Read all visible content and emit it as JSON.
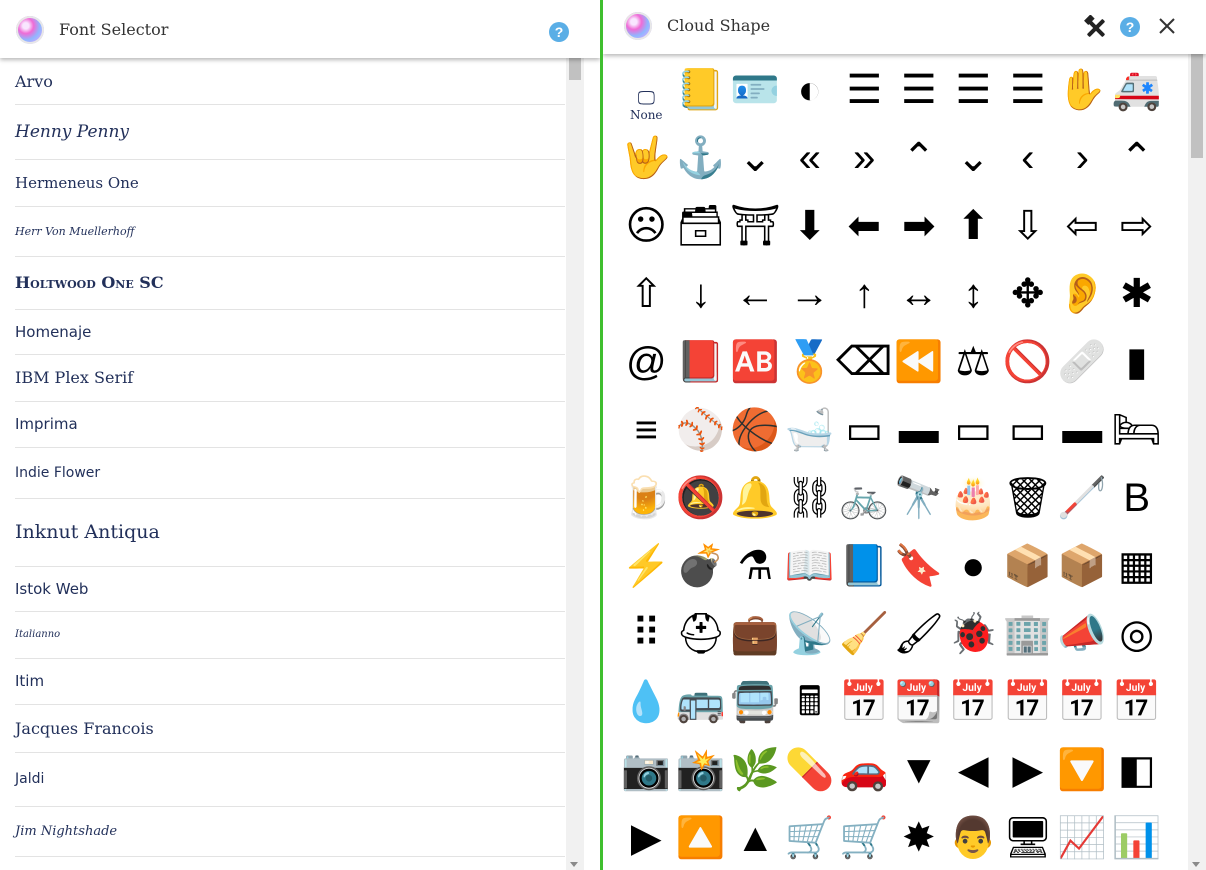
{
  "left_panel": {
    "title": "Font Selector",
    "help_icon": "?"
  },
  "fonts": [
    {
      "name": "Arvo",
      "font": "DejaVu Serif",
      "size": 16,
      "height": 46,
      "style": "normal",
      "weight": "normal",
      "variant": "normal"
    },
    {
      "name": "Henny Penny",
      "font": "DejaVu Serif",
      "size": 17,
      "height": 55,
      "style": "italic",
      "weight": "normal",
      "variant": "normal"
    },
    {
      "name": "Hermeneus One",
      "font": "DejaVu Serif",
      "size": 15,
      "height": 47,
      "style": "normal",
      "weight": "normal",
      "variant": "normal"
    },
    {
      "name": "Herr Von Muellerhoff",
      "font": "DejaVu Serif",
      "size": 11,
      "height": 50,
      "style": "italic",
      "weight": "normal",
      "variant": "normal"
    },
    {
      "name": "Holtwood One SC",
      "font": "DejaVu Serif",
      "size": 16,
      "height": 53,
      "style": "normal",
      "weight": "bold",
      "variant": "small-caps"
    },
    {
      "name": "Homenaje",
      "font": "DejaVu Sans",
      "size": 15,
      "height": 45,
      "style": "normal",
      "weight": "normal",
      "variant": "normal"
    },
    {
      "name": "IBM Plex Serif",
      "font": "DejaVu Serif",
      "size": 16,
      "height": 47,
      "style": "normal",
      "weight": "normal",
      "variant": "normal"
    },
    {
      "name": "Imprima",
      "font": "DejaVu Sans",
      "size": 15,
      "height": 46,
      "style": "normal",
      "weight": "normal",
      "variant": "normal"
    },
    {
      "name": "Indie Flower",
      "font": "DejaVu Sans",
      "size": 14,
      "height": 51,
      "style": "normal",
      "weight": "normal",
      "variant": "normal"
    },
    {
      "name": "Inknut Antiqua",
      "font": "DejaVu Serif",
      "size": 19,
      "height": 68,
      "style": "normal",
      "weight": "normal",
      "variant": "normal"
    },
    {
      "name": "Istok Web",
      "font": "DejaVu Sans",
      "size": 15,
      "height": 45,
      "style": "normal",
      "weight": "normal",
      "variant": "normal"
    },
    {
      "name": "Italianno",
      "font": "DejaVu Serif",
      "size": 10,
      "height": 47,
      "style": "italic",
      "weight": "normal",
      "variant": "normal"
    },
    {
      "name": "Itim",
      "font": "DejaVu Sans",
      "size": 15,
      "height": 46,
      "style": "normal",
      "weight": "normal",
      "variant": "normal"
    },
    {
      "name": "Jacques Francois",
      "font": "DejaVu Serif",
      "size": 16,
      "height": 48,
      "style": "normal",
      "weight": "normal",
      "variant": "normal"
    },
    {
      "name": "Jaldi",
      "font": "DejaVu Sans",
      "size": 14,
      "height": 54,
      "style": "normal",
      "weight": "normal",
      "variant": "normal"
    },
    {
      "name": "Jim Nightshade",
      "font": "DejaVu Serif",
      "size": 13,
      "height": 50,
      "style": "italic",
      "weight": "normal",
      "variant": "normal"
    }
  ],
  "right_panel": {
    "title": "Cloud Shape",
    "help_icon": "?",
    "close_icon": "✕",
    "tools_icon": "tools-icon"
  },
  "shapes_none_label": "None",
  "shapes": [
    {
      "name": "none",
      "glyph": "🖵"
    },
    {
      "name": "address-book-icon",
      "glyph": "📒"
    },
    {
      "name": "address-card-icon",
      "glyph": "🪪"
    },
    {
      "name": "adjust-icon",
      "glyph": "◐"
    },
    {
      "name": "align-center-icon",
      "glyph": "☰"
    },
    {
      "name": "align-justify-icon",
      "glyph": "☰"
    },
    {
      "name": "align-left-icon",
      "glyph": "☰"
    },
    {
      "name": "align-right-icon",
      "glyph": "☰"
    },
    {
      "name": "allergies-icon",
      "glyph": "✋"
    },
    {
      "name": "ambulance-icon",
      "glyph": "🚑"
    },
    {
      "name": "sign-language-icon",
      "glyph": "🤟"
    },
    {
      "name": "anchor-icon",
      "glyph": "⚓"
    },
    {
      "name": "angle-double-down-icon",
      "glyph": "⌄"
    },
    {
      "name": "angle-double-left-icon",
      "glyph": "«"
    },
    {
      "name": "angle-double-right-icon",
      "glyph": "»"
    },
    {
      "name": "angle-double-up-icon",
      "glyph": "⌃"
    },
    {
      "name": "angle-down-icon",
      "glyph": "⌄"
    },
    {
      "name": "angle-left-icon",
      "glyph": "‹"
    },
    {
      "name": "angle-right-icon",
      "glyph": "›"
    },
    {
      "name": "angle-up-icon",
      "glyph": "⌃"
    },
    {
      "name": "angry-icon",
      "glyph": "☹"
    },
    {
      "name": "archive-icon",
      "glyph": "🗃"
    },
    {
      "name": "archway-icon",
      "glyph": "⛩"
    },
    {
      "name": "arrow-circle-down-icon",
      "glyph": "⬇"
    },
    {
      "name": "arrow-circle-left-icon",
      "glyph": "⬅"
    },
    {
      "name": "arrow-circle-right-icon",
      "glyph": "➡"
    },
    {
      "name": "arrow-circle-up-icon",
      "glyph": "⬆"
    },
    {
      "name": "arrow-alt-circle-down-icon",
      "glyph": "⇩"
    },
    {
      "name": "arrow-alt-circle-left-icon",
      "glyph": "⇦"
    },
    {
      "name": "arrow-alt-circle-right-icon",
      "glyph": "⇨"
    },
    {
      "name": "arrow-alt-circle-up-icon",
      "glyph": "⇧"
    },
    {
      "name": "arrow-down-icon",
      "glyph": "↓"
    },
    {
      "name": "arrow-left-icon",
      "glyph": "←"
    },
    {
      "name": "arrow-right-icon",
      "glyph": "→"
    },
    {
      "name": "arrow-up-icon",
      "glyph": "↑"
    },
    {
      "name": "arrows-alt-h-icon",
      "glyph": "↔"
    },
    {
      "name": "arrows-alt-v-icon",
      "glyph": "↕"
    },
    {
      "name": "arrows-alt-icon",
      "glyph": "✥"
    },
    {
      "name": "assistive-listening-icon",
      "glyph": "👂"
    },
    {
      "name": "asterisk-icon",
      "glyph": "✱"
    },
    {
      "name": "at-icon",
      "glyph": "@"
    },
    {
      "name": "atlas-icon",
      "glyph": "📕"
    },
    {
      "name": "ad-icon",
      "glyph": "🆎"
    },
    {
      "name": "award-icon",
      "glyph": "🏅"
    },
    {
      "name": "backspace-icon",
      "glyph": "⌫"
    },
    {
      "name": "backward-icon",
      "glyph": "⏪"
    },
    {
      "name": "balance-scale-icon",
      "glyph": "⚖"
    },
    {
      "name": "ban-icon",
      "glyph": "🚫"
    },
    {
      "name": "band-aid-icon",
      "glyph": "🩹"
    },
    {
      "name": "barcode-icon",
      "glyph": "▮"
    },
    {
      "name": "bars-icon",
      "glyph": "≡"
    },
    {
      "name": "baseball-icon",
      "glyph": "⚾"
    },
    {
      "name": "basketball-icon",
      "glyph": "🏀"
    },
    {
      "name": "bath-icon",
      "glyph": "🛁"
    },
    {
      "name": "battery-empty-icon",
      "glyph": "▭"
    },
    {
      "name": "battery-full-icon",
      "glyph": "▬"
    },
    {
      "name": "battery-quarter-icon",
      "glyph": "▭"
    },
    {
      "name": "battery-half-icon",
      "glyph": "▭"
    },
    {
      "name": "battery-three-quarters-icon",
      "glyph": "▬"
    },
    {
      "name": "bed-icon",
      "glyph": "🛏"
    },
    {
      "name": "beer-icon",
      "glyph": "🍺"
    },
    {
      "name": "bell-slash-icon",
      "glyph": "🔕"
    },
    {
      "name": "bell-icon",
      "glyph": "🔔"
    },
    {
      "name": "project-diagram-icon",
      "glyph": "⛓"
    },
    {
      "name": "bicycle-icon",
      "glyph": "🚲"
    },
    {
      "name": "binoculars-icon",
      "glyph": "🔭"
    },
    {
      "name": "birthday-cake-icon",
      "glyph": "🎂"
    },
    {
      "name": "blender-icon",
      "glyph": "🗑"
    },
    {
      "name": "blind-icon",
      "glyph": "🦯"
    },
    {
      "name": "bold-icon",
      "glyph": "B"
    },
    {
      "name": "bolt-icon",
      "glyph": "⚡"
    },
    {
      "name": "bomb-icon",
      "glyph": "💣"
    },
    {
      "name": "bong-icon",
      "glyph": "⚗"
    },
    {
      "name": "book-open-icon",
      "glyph": "📖"
    },
    {
      "name": "book-icon",
      "glyph": "📘"
    },
    {
      "name": "bookmark-icon",
      "glyph": "🔖"
    },
    {
      "name": "bowling-ball-icon",
      "glyph": "●"
    },
    {
      "name": "box-open-icon",
      "glyph": "📦"
    },
    {
      "name": "box-icon",
      "glyph": "📦"
    },
    {
      "name": "boxes-icon",
      "glyph": "▦"
    },
    {
      "name": "braille-icon",
      "glyph": "⠿"
    },
    {
      "name": "medkit-icon",
      "glyph": "⛑"
    },
    {
      "name": "briefcase-icon",
      "glyph": "💼"
    },
    {
      "name": "broadcast-tower-icon",
      "glyph": "📡"
    },
    {
      "name": "broom-icon",
      "glyph": "🧹"
    },
    {
      "name": "brush-icon",
      "glyph": "🖌"
    },
    {
      "name": "bug-icon",
      "glyph": "🐞"
    },
    {
      "name": "building-icon",
      "glyph": "🏢"
    },
    {
      "name": "bullhorn-icon",
      "glyph": "📣"
    },
    {
      "name": "bullseye-icon",
      "glyph": "◎"
    },
    {
      "name": "burn-icon",
      "glyph": "💧"
    },
    {
      "name": "bus-icon",
      "glyph": "🚌"
    },
    {
      "name": "bus-alt-icon",
      "glyph": "🚍"
    },
    {
      "name": "calculator-icon",
      "glyph": "🖩"
    },
    {
      "name": "calendar-alt-icon",
      "glyph": "📅"
    },
    {
      "name": "calendar-check-icon",
      "glyph": "📆"
    },
    {
      "name": "calendar-minus-icon",
      "glyph": "📅"
    },
    {
      "name": "calendar-plus-icon",
      "glyph": "📅"
    },
    {
      "name": "calendar-times-icon",
      "glyph": "📅"
    },
    {
      "name": "calendar-icon",
      "glyph": "📅"
    },
    {
      "name": "camera-retro-icon",
      "glyph": "📷"
    },
    {
      "name": "camera-icon",
      "glyph": "📸"
    },
    {
      "name": "cannabis-icon",
      "glyph": "🌿"
    },
    {
      "name": "capsules-icon",
      "glyph": "💊"
    },
    {
      "name": "car-icon",
      "glyph": "🚗"
    },
    {
      "name": "caret-down-icon",
      "glyph": "▼"
    },
    {
      "name": "caret-left-icon",
      "glyph": "◀"
    },
    {
      "name": "caret-right-icon",
      "glyph": "▶"
    },
    {
      "name": "caret-square-down-icon",
      "glyph": "🔽"
    },
    {
      "name": "caret-square-left-icon",
      "glyph": "◧"
    },
    {
      "name": "caret-square-right-icon",
      "glyph": "▶"
    },
    {
      "name": "caret-square-up-icon",
      "glyph": "🔼"
    },
    {
      "name": "caret-up-icon",
      "glyph": "▲"
    },
    {
      "name": "cart-arrow-down-icon",
      "glyph": "🛒"
    },
    {
      "name": "cart-plus-icon",
      "glyph": "🛒"
    },
    {
      "name": "certificate-icon",
      "glyph": "✸"
    },
    {
      "name": "chalkboard-teacher-icon",
      "glyph": "👨"
    },
    {
      "name": "chalkboard-icon",
      "glyph": "🖥"
    },
    {
      "name": "chart-area-icon",
      "glyph": "📈"
    },
    {
      "name": "chart-bar-icon",
      "glyph": "📊"
    }
  ]
}
